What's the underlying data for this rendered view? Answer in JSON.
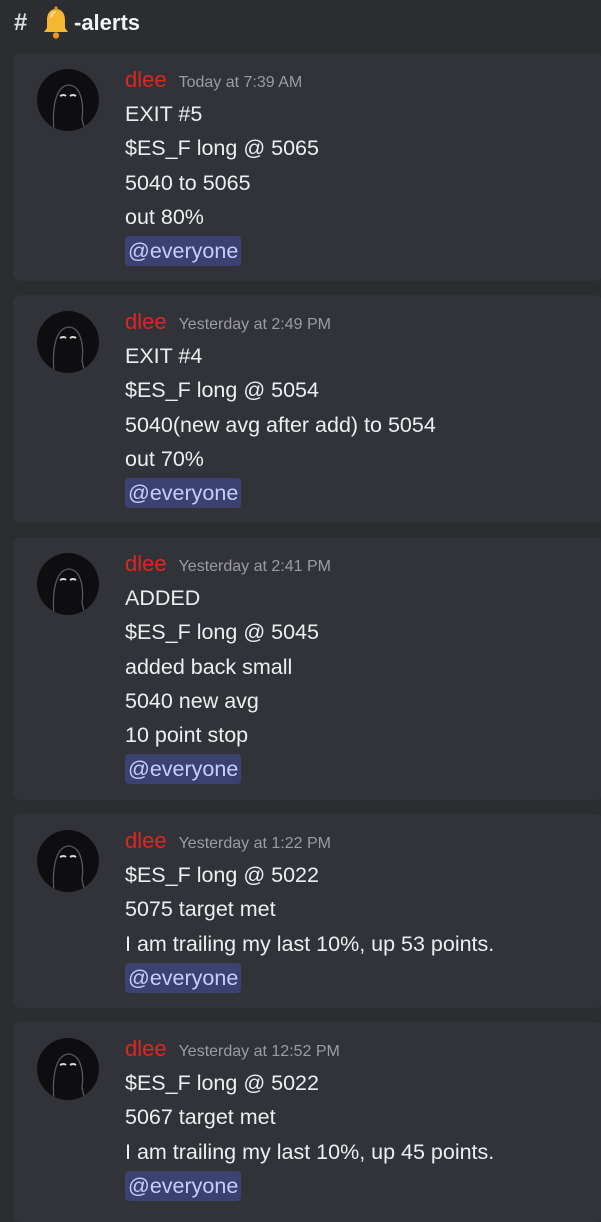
{
  "channel": {
    "name": "-alerts",
    "hash_icon": "hash-lock-icon",
    "emoji_icon": "bell-icon"
  },
  "messages": [
    {
      "author": "dlee",
      "timestamp": "Today at 7:39 AM",
      "lines": [
        "EXIT #5",
        "$ES_F long @ 5065",
        "5040 to 5065",
        "out 80%"
      ],
      "mention": "@everyone"
    },
    {
      "author": "dlee",
      "timestamp": "Yesterday at 2:49 PM",
      "lines": [
        "EXIT #4",
        "$ES_F long @ 5054",
        "5040(new avg after add) to 5054",
        "out 70%"
      ],
      "mention": "@everyone"
    },
    {
      "author": "dlee",
      "timestamp": "Yesterday at 2:41 PM",
      "lines": [
        "ADDED",
        "$ES_F long @ 5045",
        "added back small",
        "5040 new avg",
        "10 point stop"
      ],
      "mention": "@everyone"
    },
    {
      "author": "dlee",
      "timestamp": "Yesterday at 1:22 PM",
      "lines": [
        "$ES_F long @ 5022",
        "5075 target met",
        "I am trailing my last 10%, up 53 points."
      ],
      "mention": "@everyone"
    },
    {
      "author": "dlee",
      "timestamp": "Yesterday at 12:52 PM",
      "lines": [
        "$ES_F long @ 5022",
        "5067 target met",
        "I am trailing my last 10%, up 45 points."
      ],
      "mention": "@everyone"
    }
  ],
  "colors": {
    "author": "#e02424",
    "mention_bg": "#3c4270",
    "mention_text": "#c9cdfb",
    "background": "#2b2d31",
    "message_bg": "#323338"
  }
}
